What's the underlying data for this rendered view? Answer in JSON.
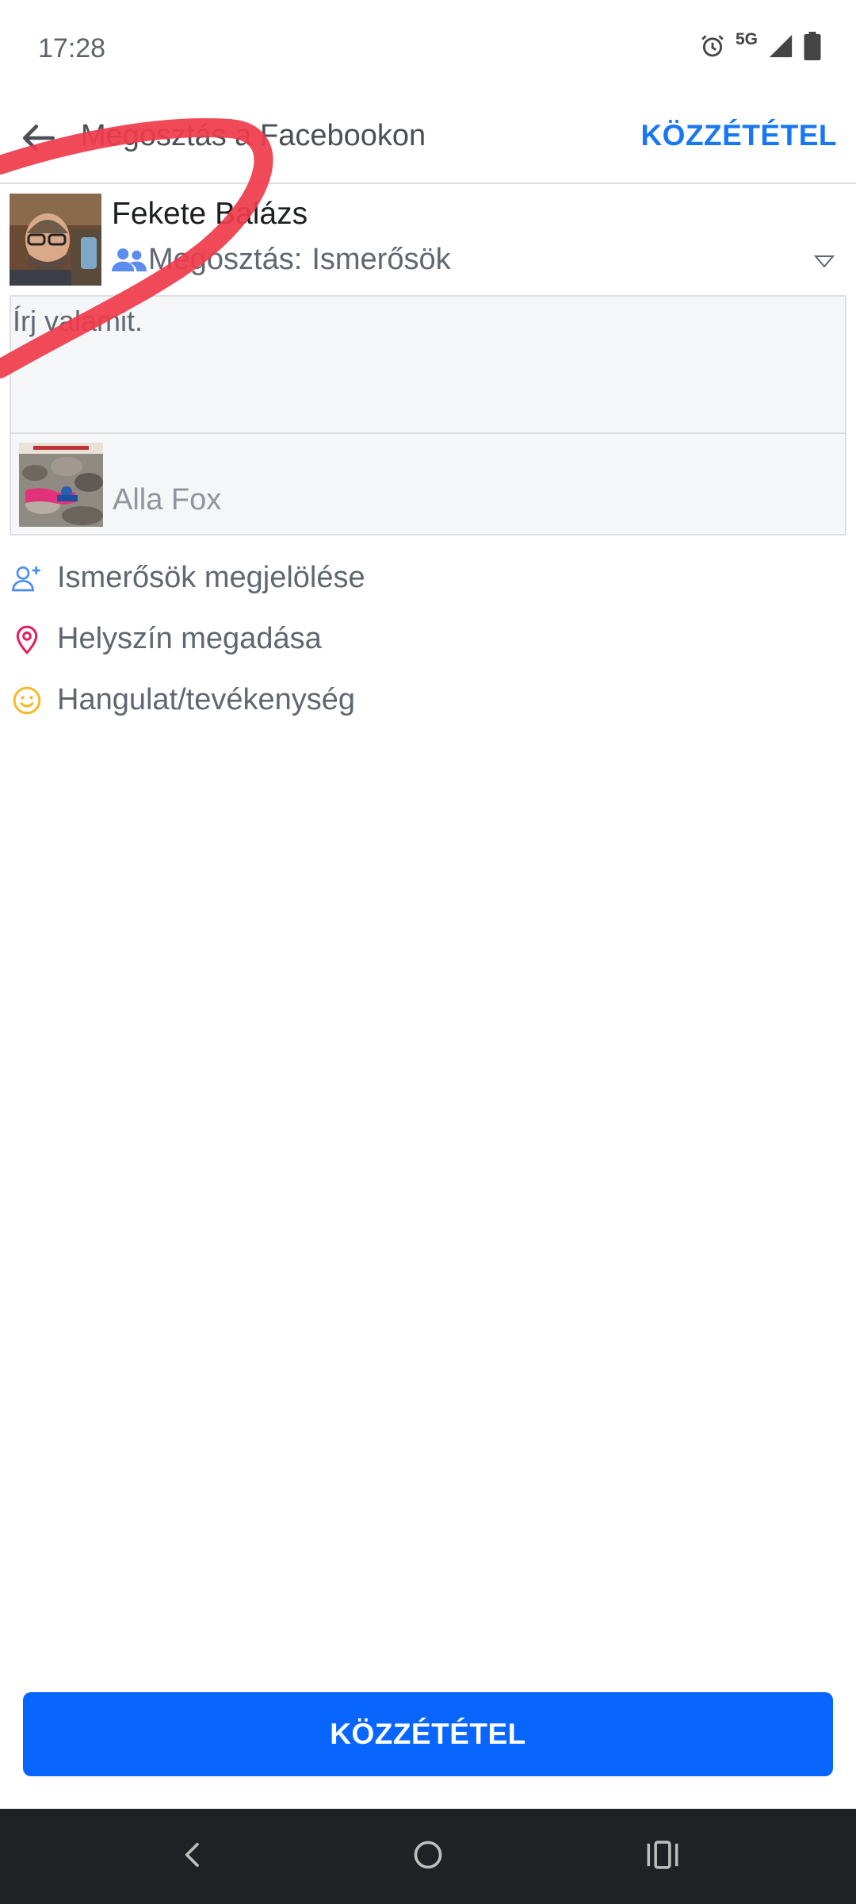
{
  "status_bar": {
    "time": "17:28",
    "network": "5G",
    "icons": [
      "alarm-icon",
      "signal-icon",
      "battery-icon"
    ]
  },
  "app_bar": {
    "title": "Megosztás a Facebookon",
    "publish_label": "KÖZZÉTÉTEL",
    "back_icon": "arrow-left-icon"
  },
  "composer": {
    "user_name": "Fekete Balázs",
    "audience_prefix": "Megosztás:",
    "audience_value": "Ismerősök",
    "input_placeholder": "Írj valamit.",
    "attachment_title": "Alla Fox"
  },
  "actions": [
    {
      "label": "Ismerősök megjelölése",
      "icon": "tag-friend-icon"
    },
    {
      "label": "Helyszín megadása",
      "icon": "location-pin-icon"
    },
    {
      "label": "Hangulat/tevékenység",
      "icon": "smiley-icon"
    }
  ],
  "bottom_button": {
    "label": "KÖZZÉTÉTEL"
  },
  "colors": {
    "accent": "#1877f2",
    "button": "#0866ff",
    "location": "#e41e5a",
    "feeling": "#f7b928",
    "scribble": "#ef3b4b"
  }
}
